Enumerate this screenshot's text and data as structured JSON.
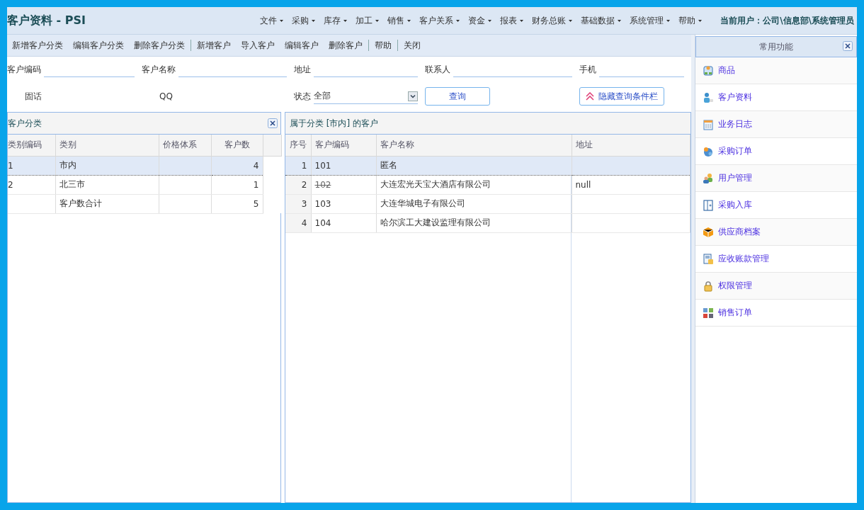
{
  "title": "客户资料 - PSI",
  "menu": [
    "文件",
    "采购",
    "库存",
    "加工",
    "销售",
    "客户关系",
    "资金",
    "报表",
    "财务总账",
    "基础数据",
    "系统管理",
    "帮助"
  ],
  "current_user": "当前用户：公司\\信息部\\系统管理员",
  "toolbar": [
    {
      "kind": "button",
      "label": "新增客户分类"
    },
    {
      "kind": "button",
      "label": "编辑客户分类"
    },
    {
      "kind": "button",
      "label": "删除客户分类"
    },
    {
      "kind": "separator"
    },
    {
      "kind": "button",
      "label": "新增客户"
    },
    {
      "kind": "button",
      "label": "导入客户"
    },
    {
      "kind": "button",
      "label": "编辑客户"
    },
    {
      "kind": "button",
      "label": "删除客户"
    },
    {
      "kind": "separator"
    },
    {
      "kind": "button",
      "label": "帮助"
    },
    {
      "kind": "separator"
    },
    {
      "kind": "button",
      "label": "关闭"
    }
  ],
  "query": {
    "fields": [
      {
        "kind": "text",
        "label": "客户编码"
      },
      {
        "kind": "text",
        "label": "客户名称"
      },
      {
        "kind": "text",
        "label": "地址"
      },
      {
        "kind": "text",
        "label": "联系人"
      },
      {
        "kind": "text",
        "label": "手机"
      },
      {
        "kind": "label",
        "label": "固话"
      },
      {
        "kind": "label",
        "label": "QQ"
      },
      {
        "kind": "select",
        "label": "状态",
        "value": "全部"
      }
    ],
    "buttons": [
      {
        "kind": "plain",
        "label": "查询"
      },
      {
        "kind": "collapse",
        "label": "隐藏查询条件栏"
      }
    ]
  },
  "category_panel": {
    "title": "客户分类",
    "columns": [
      "类别编码",
      "类别",
      "价格体系",
      "客户数"
    ],
    "rows": [
      {
        "cells": [
          "1",
          "市内",
          "",
          "4"
        ],
        "selected": true
      },
      {
        "cells": [
          "2",
          "北三市",
          "",
          "1"
        ],
        "selected": false
      },
      {
        "cells": [
          "",
          "客户数合计",
          "",
          "5"
        ],
        "selected": false
      }
    ]
  },
  "customer_panel": {
    "title": "属于分类 [市内] 的客户",
    "columns": [
      "序号",
      "客户编码",
      "客户名称",
      "地址"
    ],
    "rows": [
      {
        "cells": [
          "1",
          "101",
          "匿名",
          ""
        ],
        "selected": true,
        "deleted": false
      },
      {
        "cells": [
          "2",
          "102",
          "大连宏光天宝大酒店有限公司",
          "null"
        ],
        "selected": false,
        "deleted": true
      },
      {
        "cells": [
          "3",
          "103",
          "大连华城电子有限公司",
          ""
        ],
        "selected": false,
        "deleted": false
      },
      {
        "cells": [
          "4",
          "104",
          "哈尔滨工大建设监理有限公司",
          ""
        ],
        "selected": false,
        "deleted": false
      }
    ]
  },
  "quick_panel": {
    "title": "常用功能",
    "items": [
      {
        "label": "商品"
      },
      {
        "label": "客户资料"
      },
      {
        "label": "业务日志"
      },
      {
        "label": "采购订单"
      },
      {
        "label": "用户管理"
      },
      {
        "label": "采购入库"
      },
      {
        "label": "供应商档案"
      },
      {
        "label": "应收账款管理"
      },
      {
        "label": "权限管理"
      },
      {
        "label": "销售订单"
      }
    ]
  }
}
